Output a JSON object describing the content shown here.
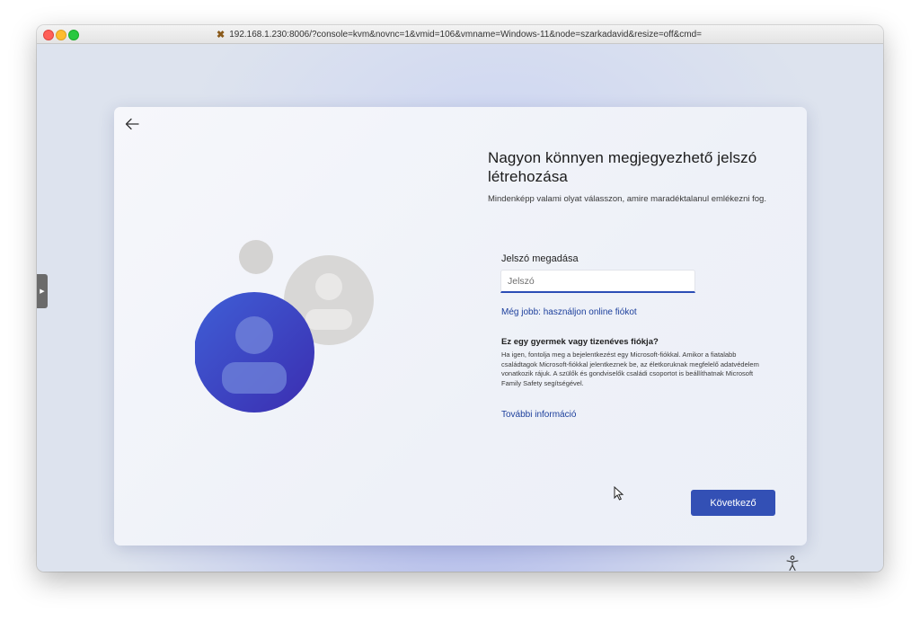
{
  "browser": {
    "url": "192.168.1.230:8006/?console=kvm&novnc=1&vmid=106&vmname=Windows-11&node=szarkadavid&resize=off&cmd=",
    "url_icon": "proxmox-icon"
  },
  "dialog": {
    "title": "Nagyon könnyen megjegyezhető jelszó létrehozása",
    "subtitle": "Mindenképp valami olyat válasszon, amire maradéktalanul emlékezni fog.",
    "field_label": "Jelszó megadása",
    "password_placeholder": "Jelszó",
    "password_value": "",
    "online_account_link": "Még jobb: használjon online fiókot",
    "child_title": "Ez egy gyermek vagy tizenéves fiókja?",
    "child_text": "Ha igen, fontolja meg a bejelentkezést egy Microsoft-fiókkal. Amikor a fiatalabb családtagok Microsoft-fiókkal jelentkeznek be, az életkoruknak megfelelő adatvédelem vonatkozik rájuk. A szülők és gondviselők családi csoportot is beállíthatnak Microsoft Family Safety segítségével.",
    "more_info_link": "További információ",
    "next_button": "Következő"
  },
  "colors": {
    "accent": "#3350b5",
    "link": "#1c3f9c",
    "avatar_front": "#3d4fc4",
    "avatar_back": "#d8d7d6"
  }
}
